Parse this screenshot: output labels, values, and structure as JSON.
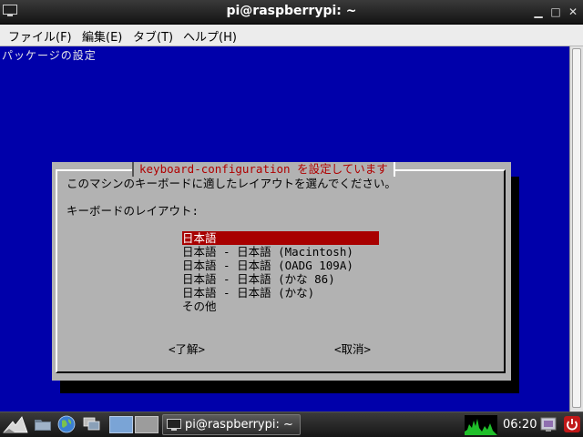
{
  "window": {
    "title": "pi@raspberrypi: ~",
    "min_glyph": "▁",
    "max_glyph": "□",
    "close_glyph": "✕"
  },
  "menubar": {
    "items": [
      {
        "label": "ファイル(F)"
      },
      {
        "label": "編集(E)"
      },
      {
        "label": "タブ(T)"
      },
      {
        "label": "ヘルプ(H)"
      }
    ]
  },
  "terminal": {
    "backtitle": "パッケージの設定",
    "dialog": {
      "title": "keyboard-configuration を設定しています",
      "prompt": "このマシンのキーボードに適したレイアウトを選んでください。",
      "list_label": "キーボードのレイアウト:",
      "options": [
        {
          "label": "日本語"
        },
        {
          "label": "日本語 - 日本語 (Macintosh)"
        },
        {
          "label": "日本語 - 日本語 (OADG 109A)"
        },
        {
          "label": "日本語 - 日本語 (かな 86)"
        },
        {
          "label": "日本語 - 日本語 (かな)"
        },
        {
          "label": "その他"
        }
      ],
      "selected_index": 0,
      "ok_button": "<了解>",
      "cancel_button": "<取消>"
    }
  },
  "taskbar": {
    "task_label": "pi@raspberrypi: ~",
    "clock": "06:20",
    "icons": [
      "lxde-start-icon",
      "file-manager-icon",
      "web-browser-icon",
      "show-windows-icon",
      "battery-icon",
      "power-icon"
    ]
  },
  "colors": {
    "terminal_bg": "#0000aa",
    "dialog_bg": "#b2b2b2",
    "selection_bg": "#a80000",
    "dialog_title": "#b00000"
  }
}
